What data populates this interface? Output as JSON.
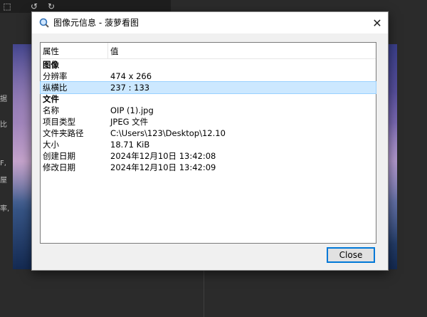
{
  "dialog": {
    "title": "图像元信息 - 菠萝看图",
    "close_button_label": "Close"
  },
  "table": {
    "headers": [
      "属性",
      "值"
    ],
    "groups": [
      {
        "name": "图像",
        "rows": [
          {
            "key": "分辨率",
            "value": "474 x 266"
          },
          {
            "key": "纵横比",
            "value": "237 : 133",
            "selected": true
          }
        ]
      },
      {
        "name": "文件",
        "rows": [
          {
            "key": "名称",
            "value": "OIP (1).jpg"
          },
          {
            "key": "项目类型",
            "value": "JPEG 文件"
          },
          {
            "key": "文件夹路径",
            "value": "C:\\Users\\123\\Desktop\\12.10"
          },
          {
            "key": "大小",
            "value": "18.71 KiB"
          },
          {
            "key": "创建日期",
            "value": "2024年12月10日 13:42:08"
          },
          {
            "key": "修改日期",
            "value": "2024年12月10日 13:42:09"
          }
        ]
      }
    ]
  },
  "background": {
    "fragments": [
      "据",
      "比",
      "F,",
      "屋",
      "率,"
    ]
  },
  "colors": {
    "selection": "#cce8ff",
    "accent": "#0078d7"
  }
}
